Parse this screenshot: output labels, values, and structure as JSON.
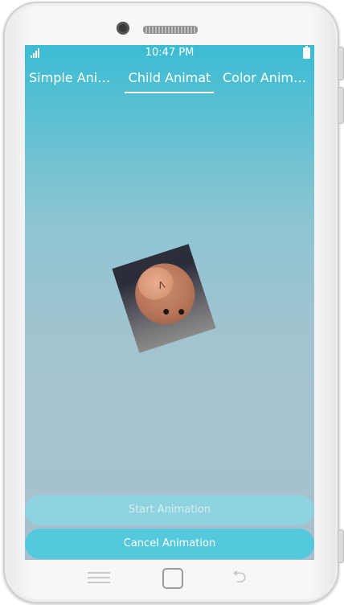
{
  "status_bar": {
    "time": "10:47 PM"
  },
  "tabs": [
    {
      "label": "Simple Animation"
    },
    {
      "label": "Child Animat"
    },
    {
      "label": "Color Animation"
    }
  ],
  "buttons": {
    "start_label": "Start Animation",
    "cancel_label": "Cancel Animation"
  },
  "colors": {
    "accent": "#54c8dd",
    "disabled": "#8fd3e0",
    "background_top": "#3bbcd3",
    "background_bottom": "#a8c0cd"
  },
  "icons": {
    "signal": "signal-icon",
    "battery": "battery-icon",
    "menu": "menu-icon",
    "home": "home-icon",
    "back": "back-icon"
  }
}
